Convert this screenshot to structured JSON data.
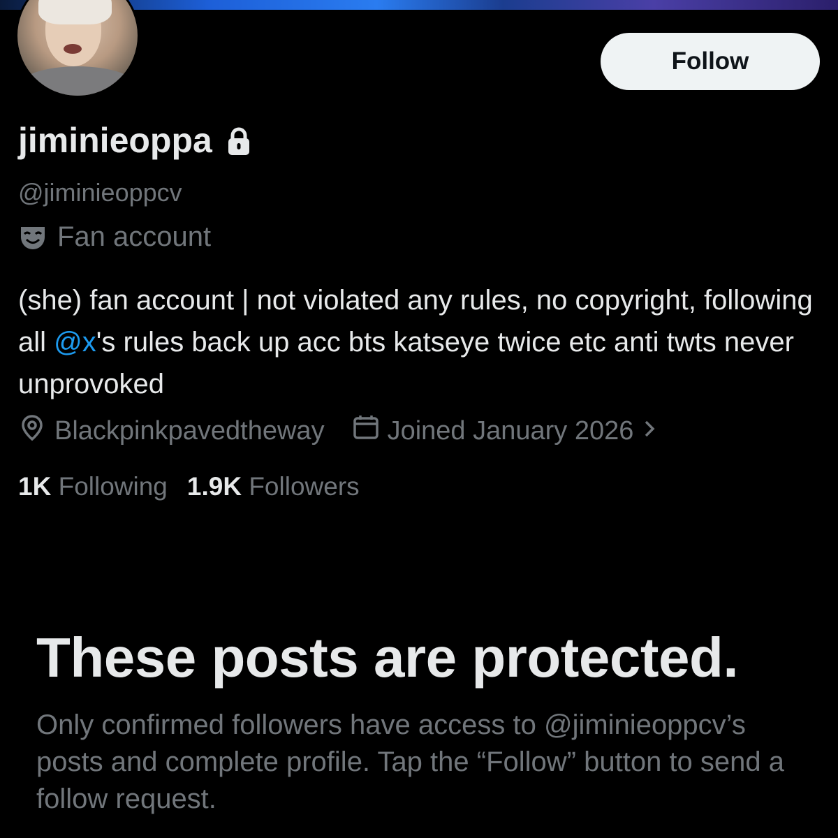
{
  "profile": {
    "display_name": "jiminieoppa",
    "handle": "@jiminieoppcv",
    "category": "Fan account",
    "bio": {
      "part1": "(she) fan account | not violated any rules, no copyright, following all ",
      "mention": "@x",
      "part2": "'s rules back up acc bts katseye twice etc anti twts never unprovoked"
    },
    "location": "Blackpinkpavedtheway",
    "joined": "Joined January 2026",
    "following_count": "1K",
    "following_label": "Following",
    "followers_count": "1.9K",
    "followers_label": "Followers"
  },
  "actions": {
    "follow_label": "Follow"
  },
  "protected": {
    "title": "These posts are protected.",
    "description": "Only confirmed followers have access to @jiminieoppcv’s posts and complete profile. Tap the “Follow” button to send a follow request."
  },
  "colors": {
    "background": "#000000",
    "text_primary": "#e7e9ea",
    "text_secondary": "#71767b",
    "link": "#1d9bf0",
    "button_bg": "#eff3f4"
  },
  "icons": {
    "lock": "lock-icon",
    "category": "mask-icon",
    "location": "location-pin-icon",
    "calendar": "calendar-icon",
    "chevron": "chevron-right-icon"
  }
}
